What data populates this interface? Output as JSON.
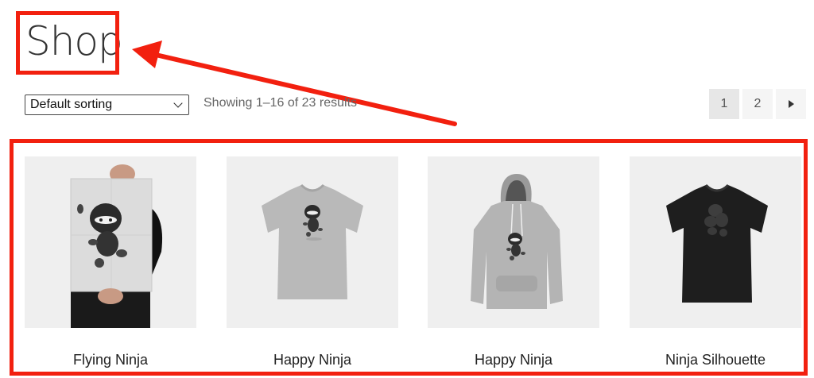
{
  "page": {
    "title": "Shop"
  },
  "toolbar": {
    "sort_selected": "Default sorting",
    "result_count": "Showing 1–16 of 23 results"
  },
  "pagination": {
    "pages": [
      "1",
      "2"
    ],
    "current": "1",
    "next_icon": "triangle-right-icon"
  },
  "products": [
    {
      "name": "Flying Ninja",
      "image": "ninja-poster-image"
    },
    {
      "name": "Happy Ninja",
      "image": "grey-tshirt-image"
    },
    {
      "name": "Happy Ninja",
      "image": "grey-hoodie-image"
    },
    {
      "name": "Ninja Silhouette",
      "image": "black-tshirt-image"
    }
  ],
  "annotation": {
    "color": "#f2200f"
  }
}
